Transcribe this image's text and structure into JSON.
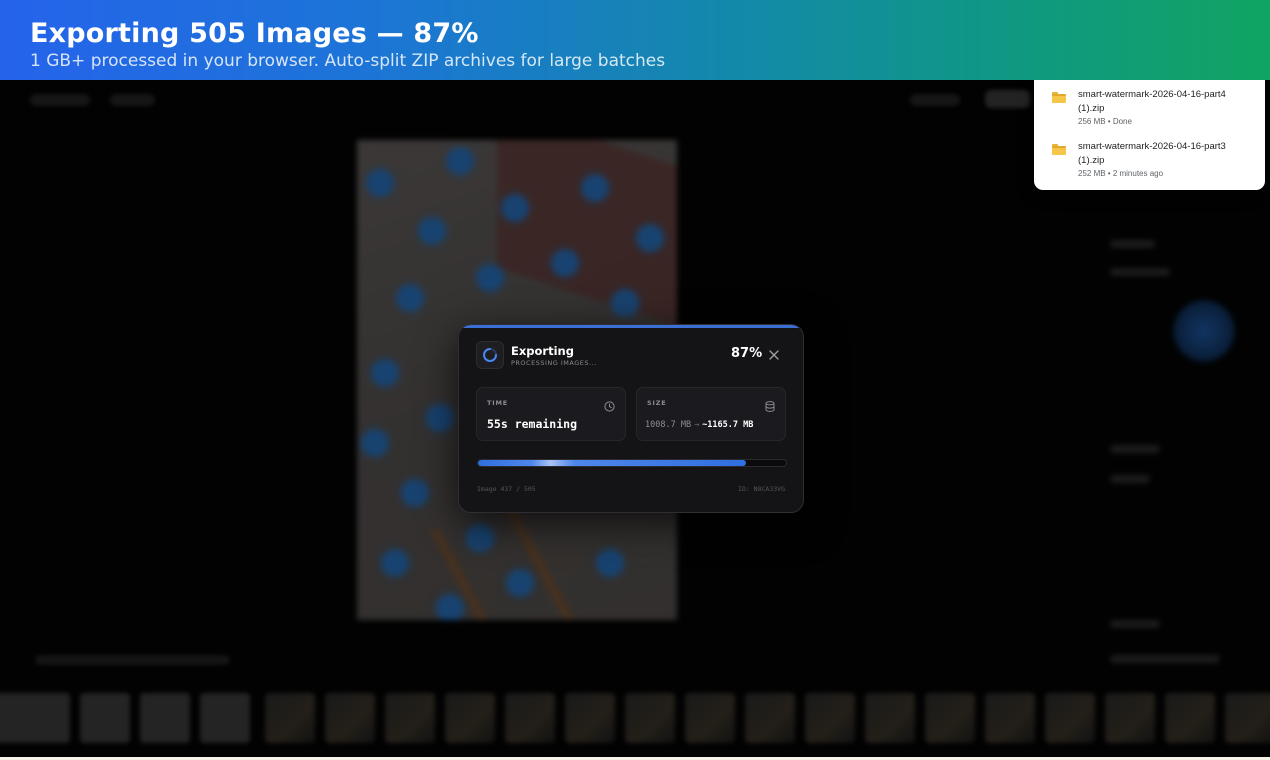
{
  "banner": {
    "title": "Exporting 505 Images — 87%",
    "subtitle": "1 GB+ processed in your browser. Auto-split ZIP archives for large batches"
  },
  "downloads": {
    "items": [
      {
        "name": "smart-watermark-2026-04-16-part4 (1).zip",
        "meta": "256 MB • Done",
        "icon": "folder-zip-icon"
      },
      {
        "name": "smart-watermark-2026-04-16-part3 (1).zip",
        "meta": "252 MB • 2 minutes ago",
        "icon": "folder-zip-icon"
      }
    ]
  },
  "export_modal": {
    "title": "Exporting",
    "subtitle": "PROCESSING IMAGES...",
    "percent_label": "87%",
    "progress": 0.87,
    "time": {
      "label": "TIME",
      "value": "55s remaining",
      "icon": "clock-icon"
    },
    "size": {
      "label": "SIZE",
      "from": "1008.7 MB",
      "arrow": "→",
      "to": "~1165.7 MB",
      "icon": "database-icon"
    },
    "footer_left": "Image 437 / 505",
    "footer_right": "ID: N8CA33VG",
    "accent_color": "#3b6fd6"
  },
  "colors": {
    "banner_gradient_start": "#2563eb",
    "banner_gradient_end": "#10a463",
    "modal_bg": "#141416"
  }
}
